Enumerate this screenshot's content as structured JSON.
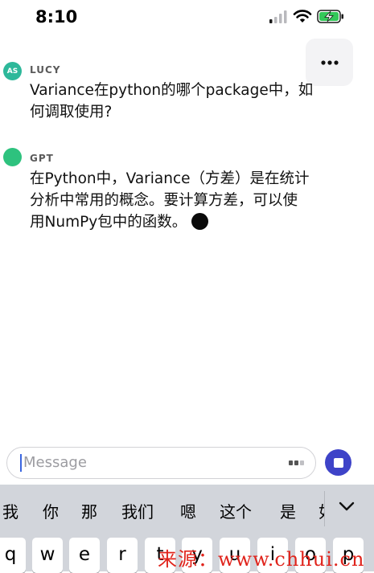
{
  "status_bar": {
    "time": "8:10"
  },
  "messages": [
    {
      "author": "LUCY",
      "avatar_initials": "AS",
      "avatar_color": "#2db89a",
      "lines": [
        "Variance在python的哪个package中，如",
        "何调取使用?"
      ]
    },
    {
      "author": "GPT",
      "avatar_color": "#2ec27e",
      "lines": [
        "在Python中，Variance（方差）是在统计",
        "分析中常用的概念。要计算方差，可以使",
        "用NumPy包中的函数。"
      ]
    }
  ],
  "composer": {
    "placeholder": "Message"
  },
  "keyboard": {
    "candidates": [
      "我",
      "你",
      "那",
      "我们",
      "嗯",
      "这个",
      "是",
      "如"
    ],
    "keys": [
      "q",
      "w",
      "e",
      "r",
      "t",
      "y",
      "u",
      "i",
      "o",
      "p"
    ]
  },
  "watermark": "来源：www.chhui.cn",
  "colors": {
    "accent": "#3e43c8",
    "keyboard_bg": "#d2d5db"
  },
  "icons": [
    "signal-icon",
    "wifi-icon",
    "battery-charging-icon",
    "more-icon",
    "voice-icon",
    "stop-icon",
    "chevron-down-icon"
  ]
}
